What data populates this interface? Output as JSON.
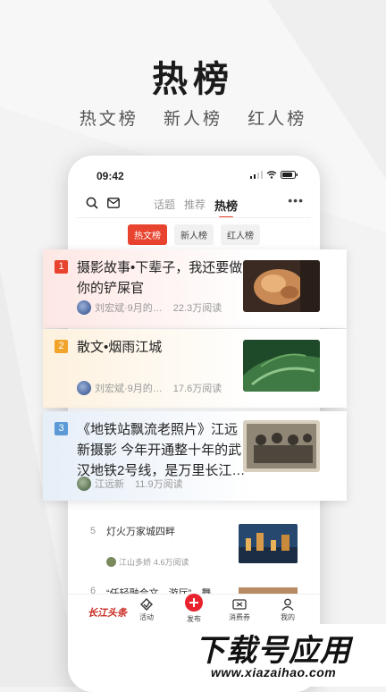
{
  "hero": {
    "title": "热榜",
    "subtitle": [
      "热文榜",
      "新人榜",
      "红人榜"
    ]
  },
  "status_bar": {
    "time": "09:42"
  },
  "app_bar": {
    "tabs": [
      "话题",
      "推荐",
      "热榜"
    ],
    "active_tab": "热榜"
  },
  "chips": [
    {
      "label": "热文榜",
      "active": true
    },
    {
      "label": "新人榜",
      "active": false
    },
    {
      "label": "红人榜",
      "active": false
    }
  ],
  "cards": [
    {
      "rank": "1",
      "rank_color": "#e8432e",
      "title": "摄影故事•下辈子，我还要做你的铲屎官",
      "author": "刘宏斌·9月的…",
      "reads": "22.3万阅读"
    },
    {
      "rank": "2",
      "rank_color": "#f0a42a",
      "title": "散文•烟雨江城",
      "author": "刘宏斌·9月的…",
      "reads": "17.6万阅读"
    },
    {
      "rank": "3",
      "rank_color": "#5b9ad6",
      "title": "《地铁站飘流老照片》江远新摄影 今年开通整十年的武汉地铁2号线，是万里长江…",
      "author": "江远新",
      "reads": "11.9万阅读"
    }
  ],
  "list": [
    {
      "rank": "5",
      "title": "灯火万家城四畔",
      "author": "江山多娇",
      "reads": "4.6万阅读"
    },
    {
      "rank": "6",
      "title": "“任轻融合文…游厅”…舞"
    }
  ],
  "bottom_nav": {
    "logo": "长江头条",
    "items": [
      {
        "label": "活动",
        "icon": "activity-icon"
      },
      {
        "label": "发布",
        "icon": "plus-icon"
      },
      {
        "label": "消费券",
        "icon": "coupon-icon"
      },
      {
        "label": "我的",
        "icon": "user-icon"
      }
    ]
  },
  "watermark": {
    "main": "下载号应用",
    "url": "www.xiazaihao.com"
  }
}
